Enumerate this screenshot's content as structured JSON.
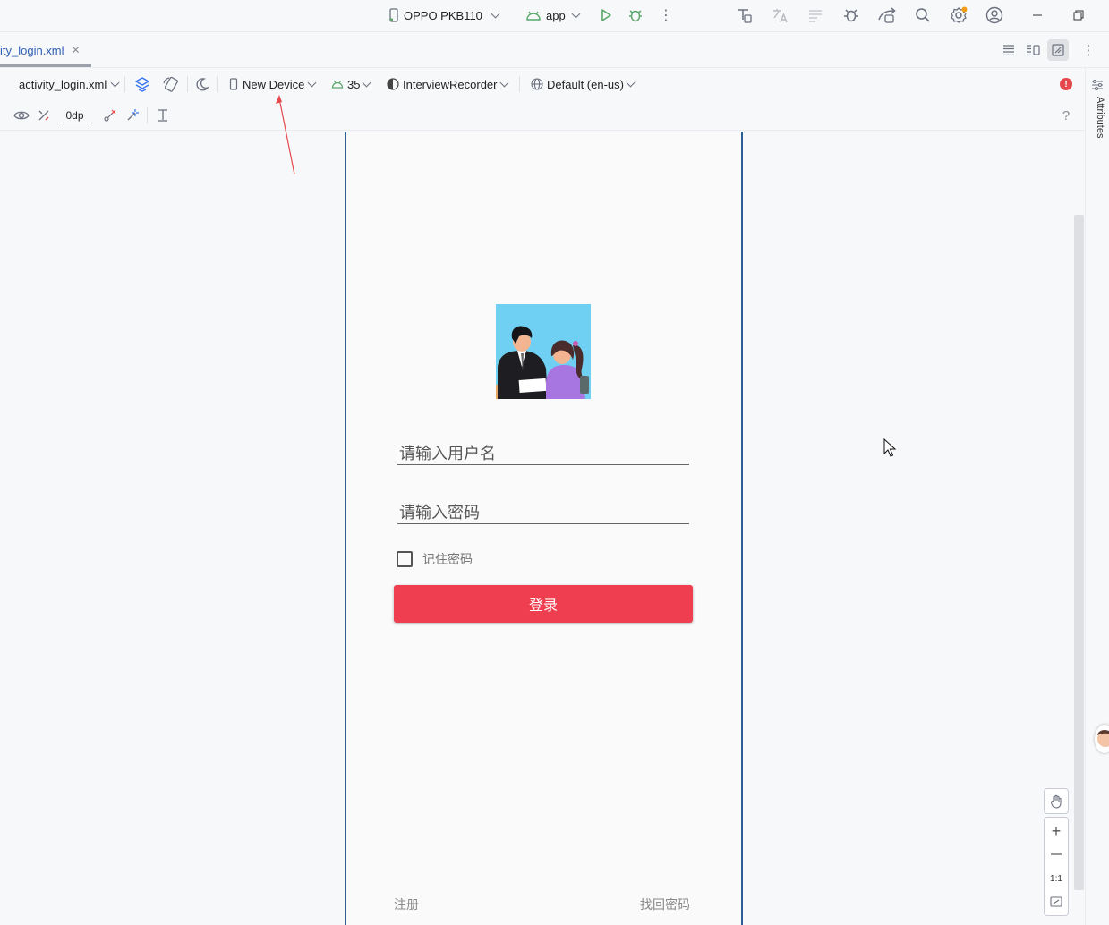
{
  "titlebar": {
    "device": "OPPO PKB110",
    "run_config": "app"
  },
  "tab": {
    "filename": "ity_login.xml"
  },
  "toolbar": {
    "file_select": "activity_login.xml",
    "device_select": "New Device",
    "api_level": "35",
    "theme": "InterviewRecorder",
    "locale": "Default (en-us)",
    "margin_value": "0dp",
    "help": "?"
  },
  "right_panel": {
    "attributes_label": "Attributes"
  },
  "login_screen": {
    "username_hint": "请输入用户名",
    "password_hint": "请输入密码",
    "remember_label": "记住密码",
    "login_button": "登录",
    "register_link": "注册",
    "recover_link": "找回密码"
  },
  "zoom": {
    "one_to_one": "1:1"
  },
  "colors": {
    "accent": "#3574f0",
    "login_button": "#ef3e4f",
    "phone_border": "#2f5d95",
    "error_badge": "#e5484d"
  }
}
